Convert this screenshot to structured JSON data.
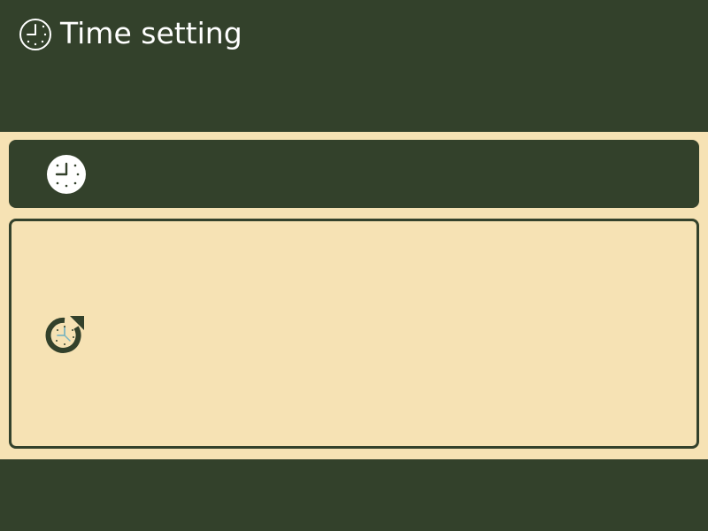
{
  "header": {
    "title": "Time setting",
    "icon": "clock-outline-icon"
  },
  "items": [
    {
      "name": "clock-setting",
      "icon": "clock-icon",
      "selected": true
    },
    {
      "name": "time-sync",
      "icon": "clock-sync-icon",
      "selected": false
    }
  ],
  "colors": {
    "primary": "#33412B",
    "background": "#F6E2B4",
    "accent": "#7FB6BF",
    "text_on_primary": "#FFFFFF"
  }
}
